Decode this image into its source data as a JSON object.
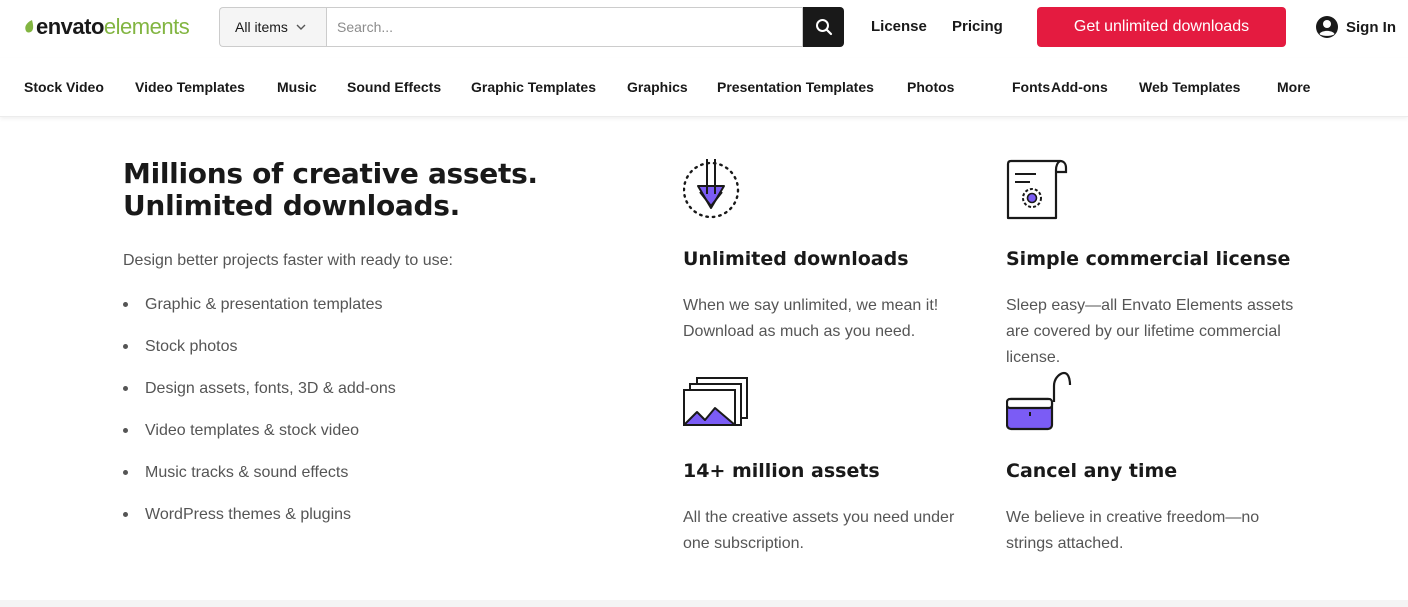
{
  "brand": {
    "word1": "envato",
    "word2": "elements",
    "green": "#82b541"
  },
  "search": {
    "scope_label": "All items",
    "placeholder": "Search...",
    "value": ""
  },
  "header": {
    "license": "License",
    "pricing": "Pricing",
    "cta": "Get unlimited downloads",
    "signin": "Sign In",
    "cta_color": "#e41b40"
  },
  "categories": [
    "Stock Video",
    "Video Templates",
    "Music",
    "Sound Effects",
    "Graphic Templates",
    "Graphics",
    "Presentation Templates",
    "Photos",
    "Fonts",
    "Add-ons",
    "Web Templates",
    "More"
  ],
  "hero": {
    "headline_line1": "Millions of creative assets.",
    "headline_line2": "Unlimited downloads.",
    "intro": "Design better projects faster with ready to use:",
    "bullets": [
      "Graphic & presentation templates",
      "Stock photos",
      "Design assets, fonts, 3D & add-ons",
      "Video templates & stock video",
      "Music tracks & sound effects",
      "WordPress themes & plugins"
    ]
  },
  "features": [
    {
      "icon": "download-arrow-icon",
      "title": "Unlimited downloads",
      "text": "When we say unlimited, we mean it! Download as much as you need."
    },
    {
      "icon": "license-certificate-icon",
      "title": "Simple commercial license",
      "text": "Sleep easy—all Envato Elements assets are covered by our lifetime commercial license."
    },
    {
      "icon": "image-stack-icon",
      "title": "14+ million assets",
      "text": "All the creative assets you need under one subscription."
    },
    {
      "icon": "open-padlock-icon",
      "title": "Cancel any time",
      "text": "We believe in creative freedom—no strings attached."
    }
  ],
  "colors": {
    "accent_purple": "#7b5cf5",
    "text_dark": "#191919",
    "text_body": "#555555"
  }
}
